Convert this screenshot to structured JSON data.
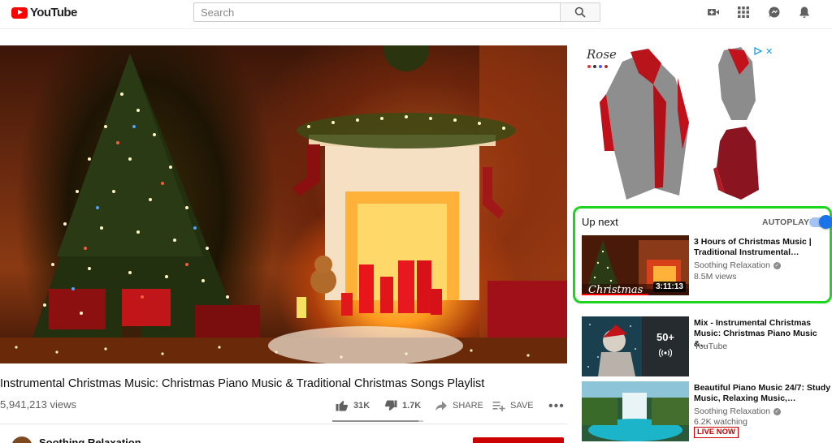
{
  "header": {
    "logo_text": "YouTube",
    "search_placeholder": "Search",
    "icons": [
      "create-video-icon",
      "apps-grid-icon",
      "messages-icon",
      "notifications-bell-icon"
    ]
  },
  "video": {
    "title": "Instrumental Christmas Music: Christmas Piano Music & Traditional Christmas Songs Playlist",
    "views": "5,941,213 views",
    "likes": "31K",
    "dislikes": "1.7K",
    "share_label": "SHARE",
    "save_label": "SAVE",
    "channel": "Soothing Relaxation"
  },
  "ad": {
    "brand": "Rose"
  },
  "up_next": {
    "label": "Up next",
    "autoplay_label": "AUTOPLAY",
    "autoplay_on": true
  },
  "recommendations": [
    {
      "title": "3 Hours of Christmas Music | Traditional Instrumental…",
      "channel": "Soothing Relaxation",
      "meta": "8.5M views",
      "duration": "3:11:13",
      "thumb_caption": "Christmas"
    },
    {
      "title": "Mix - Instrumental Christmas Music: Christmas Piano Music &…",
      "channel": "YouTube",
      "mix_count": "50+"
    },
    {
      "title": "Beautiful Piano Music 24/7: Study Music, Relaxing Music,…",
      "channel": "Soothing Relaxation",
      "meta": "6.2K watching",
      "badge": "LIVE NOW"
    }
  ],
  "colors": {
    "brand_red": "#ff0000",
    "subscribe_red": "#cc0000",
    "highlight_green": "#1ed41e",
    "toggle_blue": "#1a73e8"
  }
}
